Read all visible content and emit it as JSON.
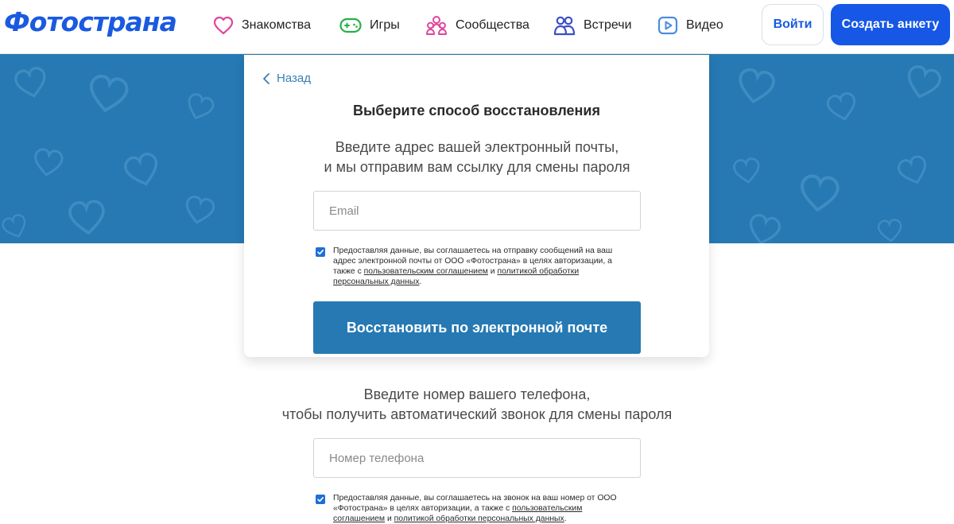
{
  "header": {
    "logo": "Фотострана",
    "nav": [
      {
        "label": "Знакомства",
        "icon": "heart-icon"
      },
      {
        "label": "Игры",
        "icon": "gamepad-icon"
      },
      {
        "label": "Сообщества",
        "icon": "community-icon"
      },
      {
        "label": "Встречи",
        "icon": "people-icon"
      },
      {
        "label": "Видео",
        "icon": "video-icon"
      }
    ],
    "login_label": "Войти",
    "create_label": "Создать анкету"
  },
  "recovery": {
    "back_label": "Назад",
    "title": "Выберите способ восстановления",
    "email": {
      "intro_line1": "Введите адрес вашей электронный почты,",
      "intro_line2": "и мы отправим вам ссылку для смены пароля",
      "placeholder": "Email",
      "consent_checked": true,
      "consent_part1": "Предоставляя данные, вы соглашаетесь на отправку сообщений на ваш адрес электронной почты от ООО «Фотострана» в целях авторизации, а также с ",
      "consent_link1": "пользовательским соглашением",
      "consent_and": " и ",
      "consent_link2": "политикой обработки персональных данных",
      "consent_end": ".",
      "submit_label": "Восстановить по электронной почте"
    },
    "phone": {
      "intro_line1": "Введите номер вашего телефона,",
      "intro_line2": "чтобы получить автоматический звонок для смены пароля",
      "placeholder": "Номер телефона",
      "consent_checked": true,
      "consent_part1": "Предоставляя данные, вы соглашаетесь на звонок на ваш номер от ООО «Фотострана» в целях авторизации, а также с ",
      "consent_link1": "пользовательским соглашением",
      "consent_and": " и ",
      "consent_link2": "политикой обработки персональных данных",
      "consent_end": "."
    }
  },
  "colors": {
    "brand_blue": "#1657e6",
    "band_blue": "#2679b3",
    "icon_pink": "#e0459c",
    "icon_green": "#26b04a",
    "icon_indigo": "#3b4fc4",
    "icon_sky": "#4a8ee0"
  }
}
